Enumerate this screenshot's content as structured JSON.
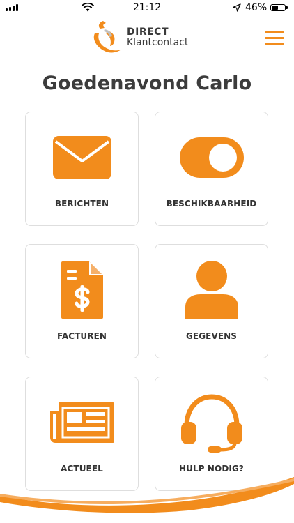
{
  "status_bar": {
    "time": "21:12",
    "battery": "46%"
  },
  "header": {
    "logo_line1": "DIRECT",
    "logo_line2": "Klantcontact"
  },
  "greeting": "Goedenavond Carlo",
  "tiles": [
    {
      "label": "BERICHTEN",
      "icon": "envelope-icon"
    },
    {
      "label": "BESCHIKBAARHEID",
      "icon": "toggle-icon"
    },
    {
      "label": "FACTUREN",
      "icon": "invoice-dollar-icon"
    },
    {
      "label": "GEGEVENS",
      "icon": "user-icon"
    },
    {
      "label": "ACTUEEL",
      "icon": "newspaper-icon"
    },
    {
      "label": "HULP NODIG?",
      "icon": "headset-icon"
    }
  ],
  "colors": {
    "accent": "#f28c1c",
    "text": "#333333",
    "tile_border": "#dedede"
  }
}
